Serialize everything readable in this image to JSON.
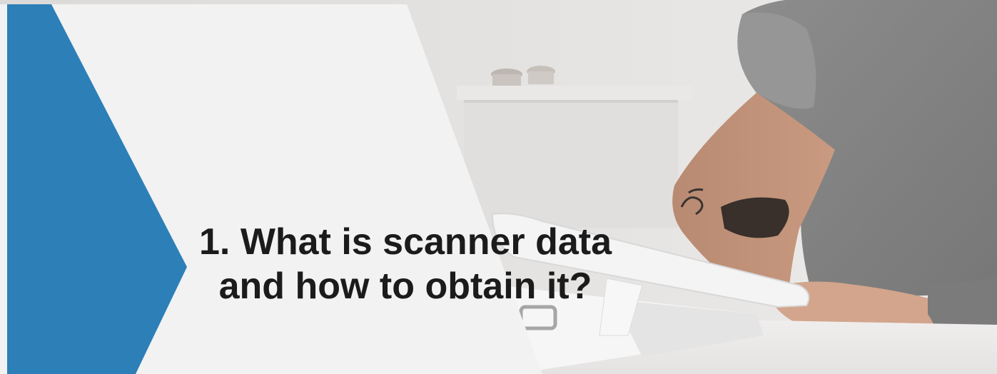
{
  "slide": {
    "title_line_1": "1. What is scanner data",
    "title_line_2": "and how to obtain it?"
  },
  "colors": {
    "accent_blue": "#2d7fb8",
    "panel_light_gray": "#f2f2f3",
    "title_text": "#1b1b1b"
  },
  "background_photo": {
    "subject": "man in grey t-shirt with forearm tattoo using a white point-of-sale scanner terminal"
  }
}
